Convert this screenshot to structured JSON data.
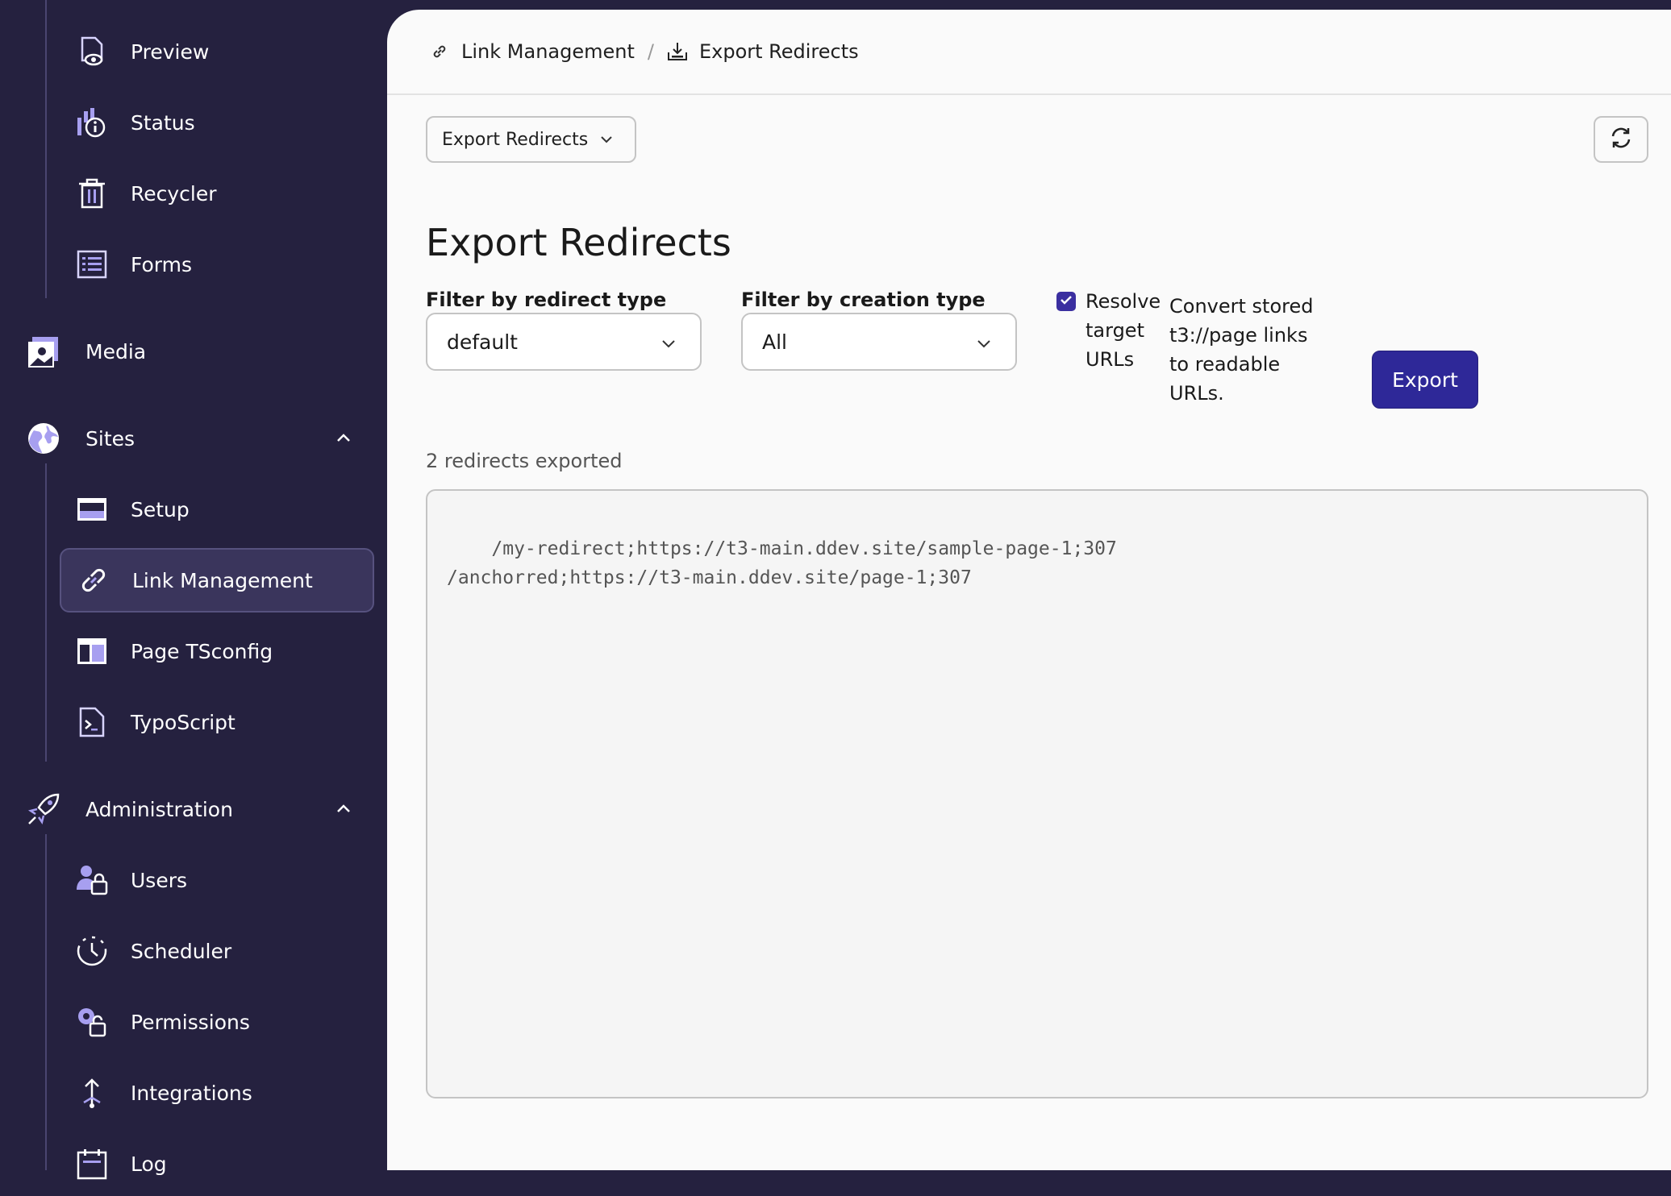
{
  "sidebar": {
    "web_subitems": [
      {
        "label": "Preview",
        "icon": "preview-icon"
      },
      {
        "label": "Status",
        "icon": "status-icon"
      },
      {
        "label": "Recycler",
        "icon": "recycler-icon"
      },
      {
        "label": "Forms",
        "icon": "forms-icon"
      }
    ],
    "media": {
      "label": "Media",
      "icon": "media-icon"
    },
    "sites": {
      "label": "Sites",
      "icon": "globe-icon",
      "items": [
        {
          "label": "Setup",
          "icon": "setup-icon"
        },
        {
          "label": "Link Management",
          "icon": "link-icon",
          "active": true
        },
        {
          "label": "Page TSconfig",
          "icon": "tsconfig-icon"
        },
        {
          "label": "TypoScript",
          "icon": "typoscript-icon"
        }
      ]
    },
    "administration": {
      "label": "Administration",
      "icon": "rocket-icon",
      "items": [
        {
          "label": "Users",
          "icon": "users-icon"
        },
        {
          "label": "Scheduler",
          "icon": "scheduler-icon"
        },
        {
          "label": "Permissions",
          "icon": "permissions-icon"
        },
        {
          "label": "Integrations",
          "icon": "integrations-icon"
        },
        {
          "label": "Log",
          "icon": "log-icon"
        }
      ]
    }
  },
  "breadcrumb": {
    "items": [
      "Link Management",
      "Export Redirects"
    ],
    "separator": "/"
  },
  "toolbar": {
    "module_select_label": "Export Redirects"
  },
  "page": {
    "title": "Export Redirects",
    "filter_redirect_type": {
      "label": "Filter by redirect type",
      "value": "default"
    },
    "filter_creation_type": {
      "label": "Filter by creation type",
      "value": "All"
    },
    "resolve_checkbox": {
      "label": "Resolve target URLs",
      "checked": true,
      "description": "Convert stored t3://page links to readable URLs."
    },
    "export_button": "Export",
    "result_count": "2 redirects exported",
    "output": "/my-redirect;https://t3-main.ddev.site/sample-page-1;307\n/anchorred;https://t3-main.ddev.site/page-1;307"
  },
  "colors": {
    "sidebar_bg": "#25213f",
    "accent": "#2e2898",
    "icon_accent": "#a79ff0"
  }
}
